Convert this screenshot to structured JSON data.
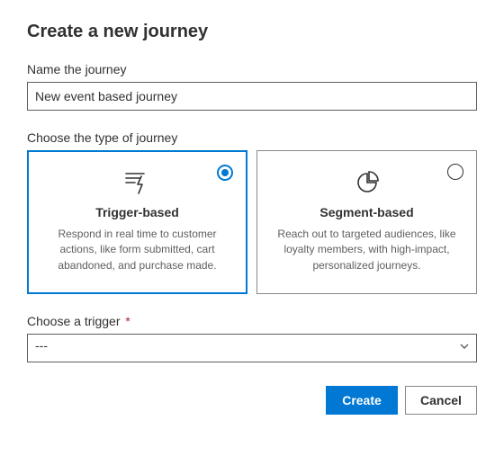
{
  "title": "Create a new journey",
  "name_field": {
    "label": "Name the journey",
    "value": "New event based journey"
  },
  "type_section": {
    "label": "Choose the type of journey",
    "options": {
      "trigger": {
        "title": "Trigger-based",
        "description": "Respond in real time to customer actions, like form submitted, cart abandoned, and purchase made.",
        "selected": true
      },
      "segment": {
        "title": "Segment-based",
        "description": "Reach out to targeted audiences, like loyalty members, with high-impact, personalized journeys.",
        "selected": false
      }
    }
  },
  "trigger_field": {
    "label": "Choose a trigger",
    "required_marker": "*",
    "value": "---"
  },
  "footer": {
    "create_label": "Create",
    "cancel_label": "Cancel"
  }
}
